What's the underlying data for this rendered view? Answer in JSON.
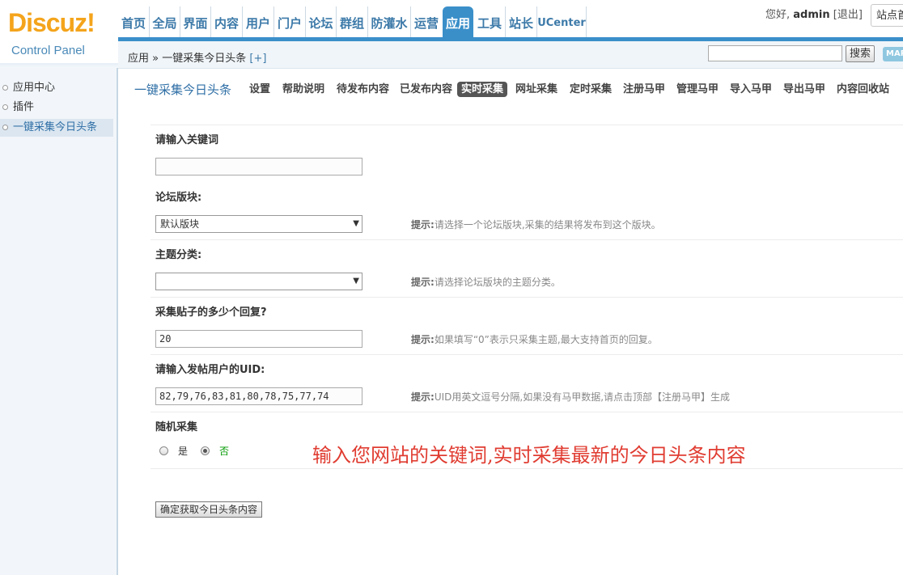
{
  "logo": {
    "brand": "Discuz!",
    "subtitle": "Control Panel"
  },
  "nav": {
    "items": [
      "首页",
      "全局",
      "界面",
      "内容",
      "用户",
      "门户",
      "论坛",
      "群组",
      "防灌水",
      "运营",
      "应用",
      "工具",
      "站长",
      "UCenter"
    ],
    "active": "应用"
  },
  "user": {
    "greeting": "您好,",
    "name": "admin",
    "logout": "[退出]",
    "site_button": "站点首"
  },
  "breadcrumb": {
    "root": "应用",
    "sep": "»",
    "current": "一键采集今日头条",
    "add": "[+]"
  },
  "search": {
    "placeholder": "",
    "button": "搜索",
    "map": "MAP"
  },
  "sidebar": {
    "items": [
      "应用中心",
      "插件",
      "一键采集今日头条"
    ],
    "active": "一键采集今日头条"
  },
  "plugin": {
    "title": "一键采集今日头条",
    "tabs": [
      "设置",
      "帮助说明",
      "待发布内容",
      "已发布内容",
      "实时采集",
      "网址采集",
      "定时采集",
      "注册马甲",
      "管理马甲",
      "导入马甲",
      "导出马甲",
      "内容回收站"
    ],
    "active_tab": "实时采集"
  },
  "form": {
    "keyword": {
      "label": "请输入关键词",
      "value": ""
    },
    "forum": {
      "label": "论坛版块:",
      "value": "默认版块",
      "hint_prefix": "提示:",
      "hint": "请选择一个论坛版块,采集的结果将发布到这个版块。"
    },
    "category": {
      "label": "主题分类:",
      "value": "",
      "hint_prefix": "提示:",
      "hint": "请选择论坛版块的主题分类。"
    },
    "replies": {
      "label": "采集贴子的多少个回复?",
      "value": "20",
      "hint_prefix": "提示:",
      "hint": "如果填写“0”表示只采集主题,最大支持首页的回复。"
    },
    "uid": {
      "label": "请输入发帖用户的UID:",
      "value": "82,79,76,83,81,80,78,75,77,74",
      "hint_prefix": "提示:",
      "hint": "UID用英文逗号分隔,如果没有马甲数据,请点击顶部【注册马甲】生成"
    },
    "random": {
      "label": "随机采集",
      "yes": "是",
      "no": "否",
      "selected": "否"
    },
    "submit": "确定获取今日头条内容"
  },
  "promo": "输入您网站的关键词,实时采集最新的今日头条内容",
  "colors": {
    "accent": "#3a8fc9",
    "promo": "#e03c31",
    "logo": "#f4a41c"
  }
}
